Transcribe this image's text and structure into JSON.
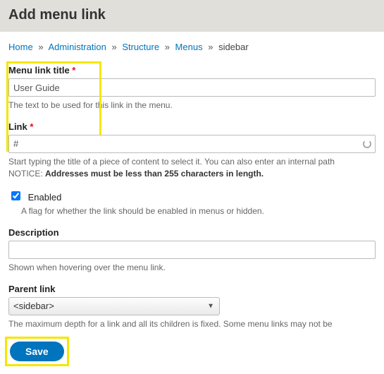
{
  "header": {
    "title": "Add menu link"
  },
  "breadcrumb": {
    "items": [
      {
        "label": "Home"
      },
      {
        "label": "Administration"
      },
      {
        "label": "Structure"
      },
      {
        "label": "Menus"
      }
    ],
    "current": "sidebar",
    "separator": "»"
  },
  "form": {
    "title": {
      "label": "Menu link title",
      "required": "*",
      "value": "User Guide",
      "description": "The text to be used for this link in the menu."
    },
    "link": {
      "label": "Link",
      "required": "*",
      "value": "#",
      "description_line1": "Start typing the title of a piece of content to select it. You can also enter an internal path",
      "description_notice_prefix": "NOTICE: ",
      "description_notice_strong": "Addresses must be less than 255 characters in length."
    },
    "enabled": {
      "label": "Enabled",
      "checked": true,
      "description": "A flag for whether the link should be enabled in menus or hidden."
    },
    "description_field": {
      "label": "Description",
      "value": "",
      "description": "Shown when hovering over the menu link."
    },
    "parent": {
      "label": "Parent link",
      "selected": "<sidebar>",
      "description": "The maximum depth for a link and all its children is fixed. Some menu links may not be"
    },
    "save_label": "Save"
  }
}
